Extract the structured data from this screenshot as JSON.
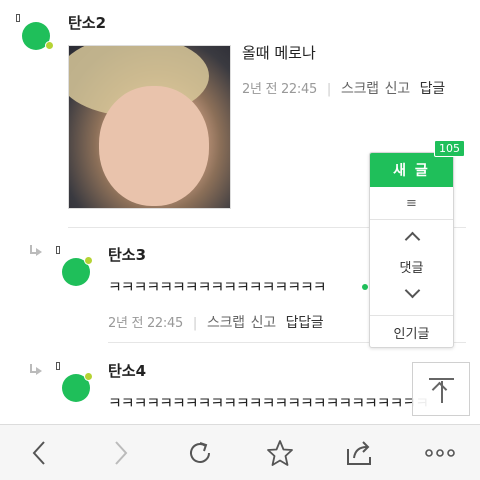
{
  "comments": [
    {
      "nickname": "탄소2",
      "text": "올때 메로나",
      "time": "2년 전 22:45",
      "scrap": "스크랩",
      "report": "신고",
      "reply": "답글"
    },
    {
      "nickname": "탄소3",
      "text": "ㅋㅋㅋㅋㅋㅋㅋㅋㅋㅋㅋㅋㅋㅋㅋㅋㅋ",
      "time": "2년 전 22:45",
      "scrap": "스크랩",
      "report": "신고",
      "reply": "답답글"
    },
    {
      "nickname": "탄소4",
      "text": "ㅋㅋㅋㅋㅋㅋㅋㅋㅋㅋㅋㅋㅋㅋㅋㅋㅋㅋㅋㅋㅋㅋㅋㅋㅋ"
    }
  ],
  "float_panel": {
    "new_post": "새 글",
    "badge": "105",
    "menu_icon": "≡",
    "comments": "댓글",
    "popular": "인기글"
  },
  "toolbar": {
    "icons": [
      "back-icon",
      "forward-icon",
      "refresh-icon",
      "star-icon",
      "share-icon",
      "more-icon"
    ]
  },
  "colors": {
    "accent": "#1fbf5a",
    "avatar_dot": "#b5d334"
  }
}
